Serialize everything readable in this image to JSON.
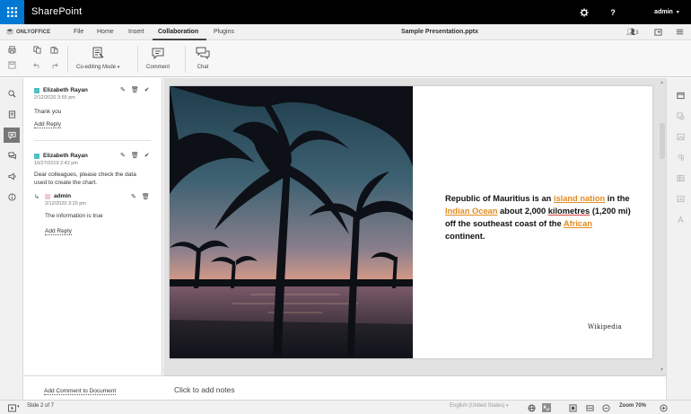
{
  "sharepoint": {
    "title": "SharePoint",
    "help_label": "?",
    "user": "admin"
  },
  "editor": {
    "brand": "ONLYOFFICE",
    "tabs": [
      "File",
      "Home",
      "Insert",
      "Collaboration",
      "Plugins"
    ],
    "active_tab": "Collaboration",
    "document_title": "Sample Presentation.pptx",
    "users_count": "3"
  },
  "toolbar": {
    "coediting_label": "Co-editing Mode",
    "comment_label": "Comment",
    "chat_label": "Chat"
  },
  "comments": [
    {
      "author": "Elizabeth Rayan",
      "date": "2/12/2020 3:55 pm",
      "text": "Thank you",
      "add_reply": "Add Reply",
      "swatch": "#4fc0c6"
    },
    {
      "author": "Elizabeth Rayan",
      "date": "10/27/2019 2:42 pm",
      "text": "Dear colleagues, please check the data used to create the chart.",
      "swatch": "#4fc0c6",
      "reply": {
        "author": "admin",
        "date": "2/12/2020 3:20 pm",
        "text": "The information is true",
        "add_reply": "Add Reply",
        "swatch": "#f3c6d3"
      }
    }
  ],
  "add_comment_label": "Add Comment to Document",
  "slide": {
    "text_parts": {
      "p1": "Republic of Mauritius is an ",
      "link1": "island nation",
      "p2": " in the ",
      "link2": "Indian Ocean",
      "p3": " about 2,000 ",
      "ul1": "kilometres",
      "p4": " (1,200 mi) off the southeast coast of the ",
      "link3": "African",
      "p5": " continent."
    },
    "logo": "Wikipedia"
  },
  "notes_placeholder": "Click to add notes",
  "status": {
    "slide_counter": "Slide 2 of 7",
    "language": "English (United States)",
    "zoom": "Zoom 70%"
  },
  "colors": {
    "sharepoint_blue": "#0078d4",
    "link_orange": "#e38b1e",
    "comment_swatch": "#4fc0c6"
  }
}
